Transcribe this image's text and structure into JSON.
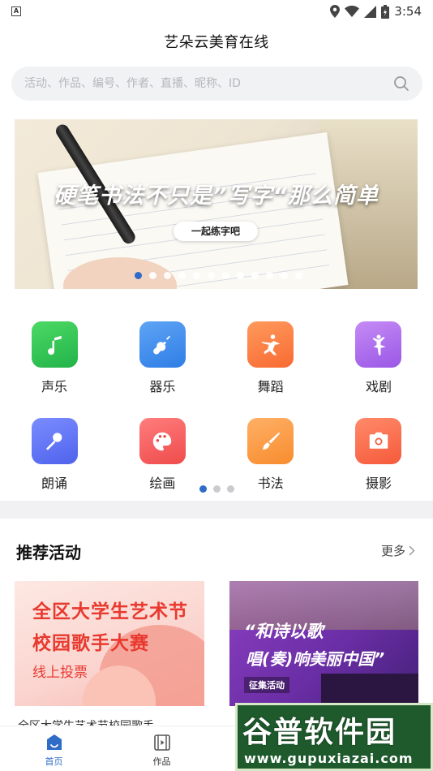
{
  "status_bar": {
    "time": "3:54"
  },
  "app": {
    "title": "艺朵云美育在线"
  },
  "search": {
    "placeholder": "活动、作品、编号、作者、直播、昵称、ID"
  },
  "banner": {
    "headline": "硬笔书法不只是”写字“那么简单",
    "pill": "一起练字吧",
    "dot_count": 12,
    "active_dot": 0
  },
  "categories": {
    "rows": [
      [
        {
          "label": "声乐",
          "icon": "music-note-icon",
          "color_from": "#4cd964",
          "color_to": "#22b34a"
        },
        {
          "label": "器乐",
          "icon": "guitar-icon",
          "color_from": "#5ea4f5",
          "color_to": "#2f7ee6"
        },
        {
          "label": "舞蹈",
          "icon": "dancer-icon",
          "color_from": "#ff9a5c",
          "color_to": "#f86a33"
        },
        {
          "label": "戏剧",
          "icon": "ballet-icon",
          "color_from": "#c58bf5",
          "color_to": "#9a57e6"
        }
      ],
      [
        {
          "label": "朗诵",
          "icon": "microphone-icon",
          "color_from": "#7b8cff",
          "color_to": "#4f63ec"
        },
        {
          "label": "绘画",
          "icon": "palette-icon",
          "color_from": "#ff7d7d",
          "color_to": "#ef4b4b"
        },
        {
          "label": "书法",
          "icon": "brush-icon",
          "color_from": "#ffb066",
          "color_to": "#f88c2e"
        },
        {
          "label": "摄影",
          "icon": "camera-icon",
          "color_from": "#ff8a6a",
          "color_to": "#f55a3a"
        }
      ]
    ],
    "dot_count": 3,
    "active_dot": 0
  },
  "recommended": {
    "title": "推荐活动",
    "more_label": "更多",
    "cards": [
      {
        "line1": "全区大学生艺术节",
        "line2": "校园歌手大赛",
        "line3": "线上投票"
      },
      {
        "line1": "“和诗以歌",
        "line2": "唱(奏)响美丽中国”",
        "badge": "征集活动"
      }
    ],
    "caption": "全区大学生艺术节校园歌手"
  },
  "tab_bar": {
    "tabs": [
      {
        "label": "首页",
        "icon": "home-icon",
        "active": true
      },
      {
        "label": "作品",
        "icon": "video-icon",
        "active": false
      },
      {
        "label": "",
        "icon": "",
        "active": false
      },
      {
        "label": "",
        "icon": "",
        "active": false
      }
    ]
  },
  "watermark": {
    "text": "谷普软件园",
    "url": "www.gupuxiazai.com"
  },
  "colors": {
    "accent": "#2f6cc8",
    "title_red": "#e8392f"
  }
}
